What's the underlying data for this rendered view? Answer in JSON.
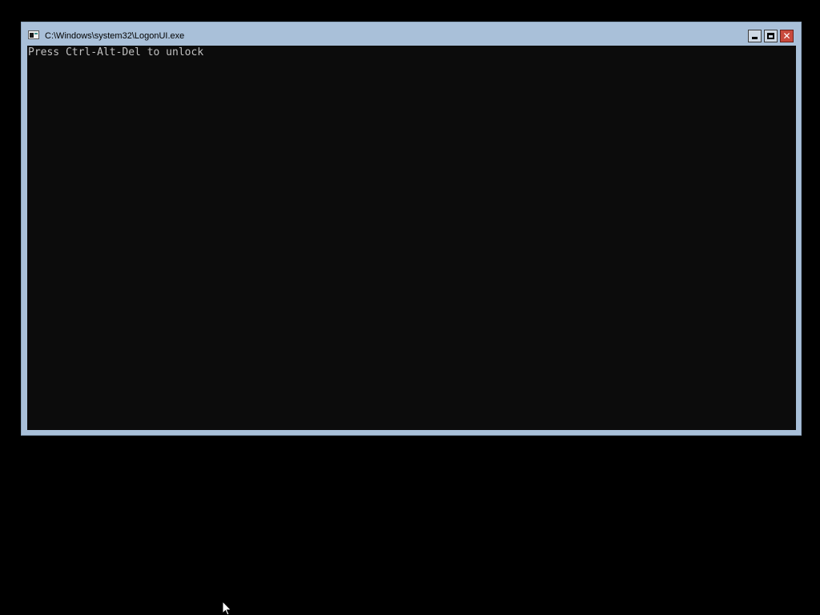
{
  "window": {
    "title": "C:\\Windows\\system32\\LogonUI.exe",
    "buttons": {
      "minimize_icon": "minimize-icon",
      "maximize_icon": "maximize-icon",
      "close_icon": "close-icon",
      "close_glyph": "✕"
    },
    "colors": {
      "frame": "#a9c0d9",
      "console_background": "#0c0c0c",
      "console_text": "#c0c0c0",
      "close_button": "#c94a3d"
    }
  },
  "console": {
    "lines": [
      "Press Ctrl-Alt-Del to unlock"
    ]
  },
  "desktop": {
    "background": "#000000",
    "cursor_icon": "mouse-pointer-icon"
  }
}
